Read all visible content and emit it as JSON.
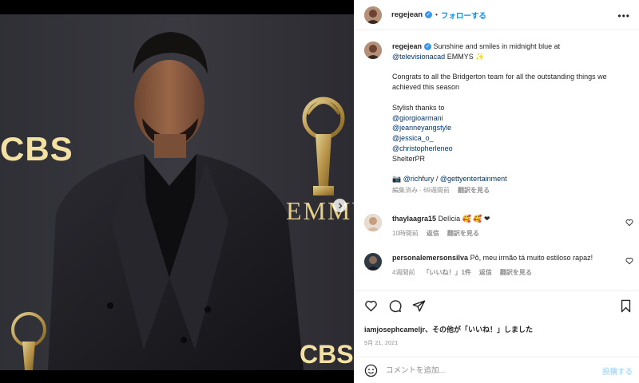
{
  "header": {
    "username": "regejean",
    "follow_label": "フォローする",
    "separator": "•",
    "more_label": "•••"
  },
  "photo": {
    "sign_left": "CBS",
    "sign_right": "EMMYS",
    "sign_bottom": "CBS"
  },
  "caption": {
    "username": "regejean",
    "line1": "Sunshine and smiles in midnight blue at",
    "mention_academy": "@televisionacad",
    "emmys": "EMMYS ✨",
    "para2": "Congrats to all the Bridgerton team for all the outstanding things we achieved this season",
    "thanks": "Stylish thanks to",
    "credits": [
      "@giorgioarmani",
      "@jeanneyangstyle",
      "@jessica_o_",
      "@christopherleneo"
    ],
    "shelter": "ShelterPR",
    "camera": "📷",
    "photo_credit_1": "@richfury",
    "photo_credit_sep": " / ",
    "photo_credit_2": "@gettyentertainment",
    "meta_time": "編集済み · 69週間前",
    "translate": "翻訳を見る"
  },
  "comments": [
    {
      "username": "thaylaagra15",
      "text": "Delícia 🥰 🥰 ❤",
      "time": "10時間前",
      "reply": "返信",
      "translate": "翻訳を見る"
    },
    {
      "username": "personalemersonsilva",
      "text": "Pô, meu irmão tá muito estiloso rapaz!",
      "time": "4週間前",
      "likes": "「いいね！」1件",
      "reply": "返信",
      "translate": "翻訳を見る"
    }
  ],
  "actions": {
    "liked_by_user": "iamjosephcameljr",
    "liked_by_suffix": "、その他が「いいね！」しました",
    "date": "9月 21, 2021"
  },
  "add_comment": {
    "placeholder": "コメントを追加...",
    "post_label": "投稿する"
  },
  "colors": {
    "accent": "#0095f6",
    "verified": "#3897f0",
    "mention": "#00376b",
    "muted": "#8e8e8e"
  }
}
